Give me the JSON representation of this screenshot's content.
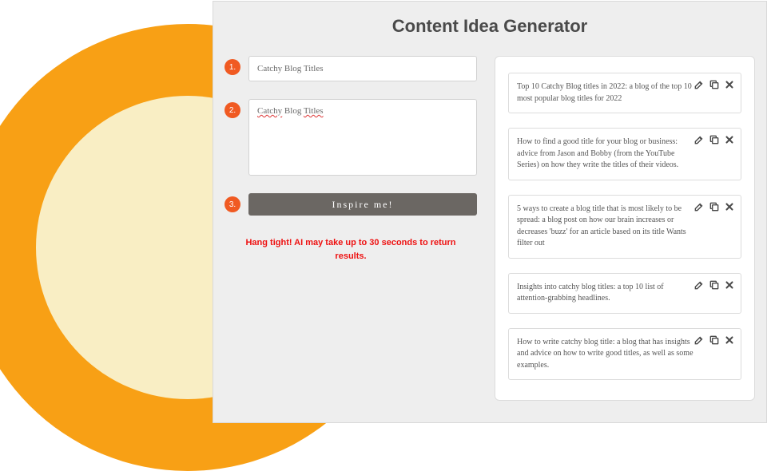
{
  "title": "Content Idea Generator",
  "steps": {
    "one": "1.",
    "two": "2.",
    "three": "3."
  },
  "input": {
    "value": "Catchy Blog Titles"
  },
  "textarea": {
    "part1": "Catchy",
    "part2": " Blog ",
    "part3": "Titles"
  },
  "button": {
    "label": "Inspire me!"
  },
  "status": "Hang tight! AI may take up to 30 seconds to return results.",
  "results": [
    "Top 10 Catchy Blog titles in 2022: a blog of the top 10 most popular blog titles for 2022",
    "How to find a good title for your blog or business: advice from Jason and Bobby (from the YouTube Series) on how they write the titles of their videos.",
    "5 ways to create a blog title that is most likely to be spread: a blog post on how our brain increases or decreases 'buzz' for an article based on its title Wants filter out",
    "Insights into catchy blog titles: a top 10 list of attention-grabbing headlines.",
    "How to write catchy blog title: a blog that has insights and advice on how to write good titles, as well as some examples."
  ]
}
